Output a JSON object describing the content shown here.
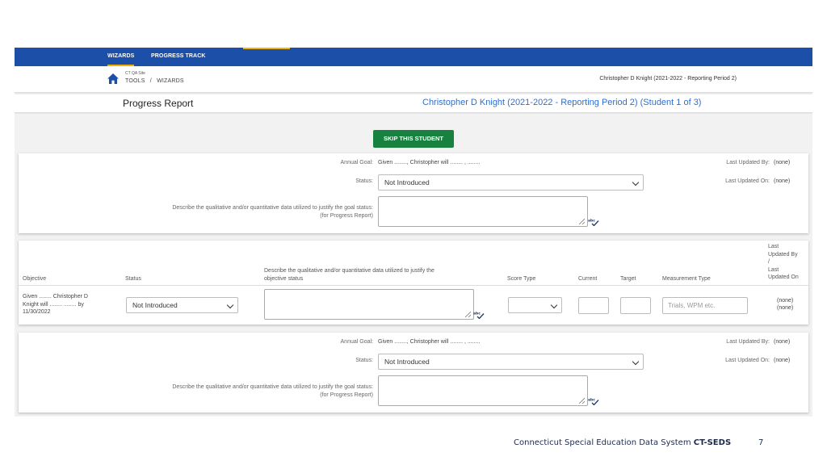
{
  "nav": {
    "tabs": [
      {
        "label": "WIZARDS",
        "active": true
      },
      {
        "label": "PROGRESS TRACK",
        "active": false
      }
    ]
  },
  "breadcrumb": {
    "site": "CT QA Site",
    "items": [
      "TOOLS",
      "/",
      "WIZARDS"
    ],
    "student_info": "Christopher D Knight (2021-2022 - Reporting Period 2)"
  },
  "header": {
    "page_title": "Progress Report",
    "student_title": "Christopher D Knight (2021-2022 - Reporting Period 2) (Student 1 of 3)"
  },
  "skip_button_label": "SKIP THIS STUDENT",
  "goals": [
    {
      "annual_goal_label": "Annual Goal:",
      "annual_goal_value": "Given ........, Christopher will ........ , ........",
      "last_updated_by_label": "Last Updated By:",
      "last_updated_by_value": "(none)",
      "status_label": "Status:",
      "status_value": "Not Introduced",
      "last_updated_on_label": "Last Updated On:",
      "last_updated_on_value": "(none)",
      "describe_label_1": "Describe the qualitative and/or quantitative data utilized to justify the goal status:",
      "describe_label_2": "(for Progress Report)"
    },
    {
      "annual_goal_label": "Annual Goal:",
      "annual_goal_value": "Given ........, Christopher will ........ , ........",
      "last_updated_by_label": "Last Updated By:",
      "last_updated_by_value": "(none)",
      "status_label": "Status:",
      "status_value": "Not Introduced",
      "last_updated_on_label": "Last Updated On:",
      "last_updated_on_value": "(none)",
      "describe_label_1": "Describe the qualitative and/or quantitative data utilized to justify the goal status:",
      "describe_label_2": "(for Progress Report)"
    }
  ],
  "objectives_table": {
    "headers": {
      "objective": "Objective",
      "status": "Status",
      "describe_1": "Describe the qualitative and/or quantitative data utilized to justify the",
      "describe_2": "objective status",
      "score_type": "Score Type",
      "current": "Current",
      "target": "Target",
      "measurement_type": "Measurement Type",
      "last_updated_1": "Last",
      "last_updated_2": "Updated By",
      "last_updated_3": "/",
      "last_updated_4": "Last",
      "last_updated_5": "Updated On"
    },
    "row": {
      "objective_1": "Given ........ Christopher D",
      "objective_2": "Knight will ........ ........ by",
      "objective_3": "11/30/2022",
      "status_value": "Not Introduced",
      "score_type_value": "",
      "current_value": "",
      "target_value": "",
      "measurement_placeholder": "Trials, WPM etc.",
      "updated_by": "(none)",
      "updated_on": "(none)"
    }
  },
  "footer": {
    "text": "Connecticut Special Education Data System",
    "brand": "CT-SEDS",
    "page_number": "7"
  },
  "icons": {
    "home": "home-icon",
    "spellcheck": "spellcheck-icon",
    "dropdown": "chevron-down-icon",
    "resize": "resize-grip-icon"
  },
  "colors": {
    "nav_bg": "#1c4fa8",
    "nav_accent": "#f0b400",
    "skip_button": "#17813f",
    "student_title": "#2a6fd6"
  }
}
